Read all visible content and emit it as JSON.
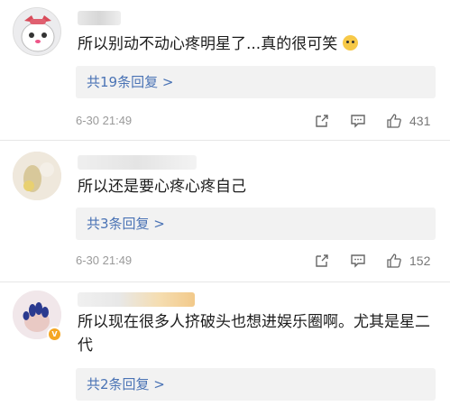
{
  "comments": [
    {
      "text": "所以别动不动心疼明星了...真的很可笑",
      "reply_label": "共19条回复 >",
      "time": "6-30 21:49",
      "likes": "431",
      "emoji_icon": "crying-laugh-emoji"
    },
    {
      "text": "所以还是要心疼心疼自己",
      "reply_label": "共3条回复 >",
      "time": "6-30 21:49",
      "likes": "152"
    },
    {
      "text": "所以现在很多人挤破头也想进娱乐圈啊。尤其是星二代",
      "reply_label": "共2条回复 >"
    }
  ],
  "icons": {
    "share": "share-icon",
    "comment": "comment-icon",
    "like": "thumbs-up-icon"
  },
  "colors": {
    "link": "#4a73b5",
    "reply_bg": "#f2f2f2",
    "meta_text": "#9a9a9a"
  }
}
